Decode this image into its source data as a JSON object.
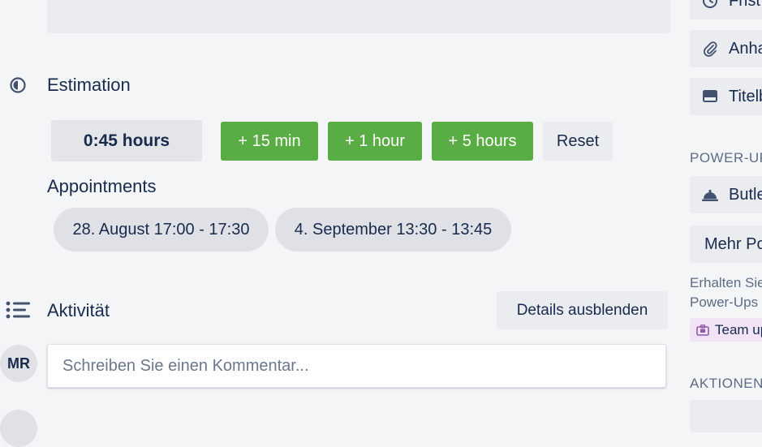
{
  "estimation": {
    "title": "Estimation",
    "value": "0:45 hours",
    "buttons": {
      "add_15": "+ 15 min",
      "add_1h": "+ 1 hour",
      "add_5h": "+ 5 hours",
      "reset": "Reset"
    }
  },
  "appointments": {
    "title": "Appointments",
    "items": [
      "28. August 17:00 - 17:30",
      "4. September 13:30 - 13:45"
    ]
  },
  "activity": {
    "title": "Aktivität",
    "details_button": "Details ausblenden",
    "avatar_initials": "MR",
    "comment_placeholder": "Schreiben Sie einen Kommentar..."
  },
  "sidebar": {
    "buttons": {
      "frist": "Frist",
      "anhang": "Anhang",
      "titel": "Titelbild",
      "butler": "Butler",
      "mehr": "Mehr Power-Ups"
    },
    "power_ups_heading": "POWER-UPS",
    "note_line1": "Erhalten Sie",
    "note_line2": "Power-Ups",
    "team_badge": "Team upgrade",
    "aktionen_heading": "AKTIONEN"
  },
  "colors": {
    "green": "#5aac44",
    "background": "#f4f5f7",
    "text": "#172b4d",
    "muted": "#5e6c84",
    "badge_bg": "#f3e3f7"
  },
  "icons": {
    "estimation": "half-circle-icon",
    "activity": "list-icon",
    "frist": "clock-icon",
    "anhang": "paperclip-icon",
    "titel": "card-cover-icon",
    "butler": "butler-bell-icon",
    "team": "briefcase-icon"
  }
}
